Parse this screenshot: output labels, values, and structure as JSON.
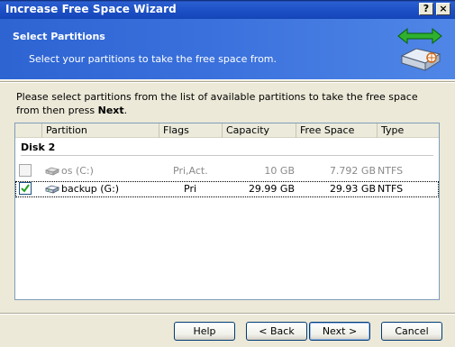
{
  "window": {
    "title": "Increase Free Space Wizard",
    "help_btn": "?",
    "close_btn": "×"
  },
  "header": {
    "title": "Select Partitions",
    "subtitle": "Select your partitions to take the free space from."
  },
  "instruction": {
    "text": "Please select partitions from the list of available partitions to take the free space from then press ",
    "bold": "Next",
    "end": "."
  },
  "list": {
    "columns": [
      "Partition",
      "Flags",
      "Capacity",
      "Free Space",
      "Type"
    ],
    "group": "Disk 2",
    "rows": [
      {
        "partition": "os (C:)",
        "flags": "Pri,Act.",
        "capacity": "10 GB",
        "free_space": "7.792 GB",
        "type": "NTFS",
        "checked": false,
        "enabled": false
      },
      {
        "partition": "backup (G:)",
        "flags": "Pri",
        "capacity": "29.99 GB",
        "free_space": "29.93 GB",
        "type": "NTFS",
        "checked": true,
        "enabled": true
      }
    ]
  },
  "buttons": {
    "help": "Help",
    "back": "< Back",
    "next": "Next >",
    "cancel": "Cancel"
  },
  "colors": {
    "title_bar": "#1c4ec4",
    "header_bg": "#3a70dc",
    "dialog_bg": "#ece9d8",
    "check_green": "#21a121"
  },
  "icons": {
    "header": "drive-arrows-icon",
    "row": "hard-drive-icon"
  }
}
